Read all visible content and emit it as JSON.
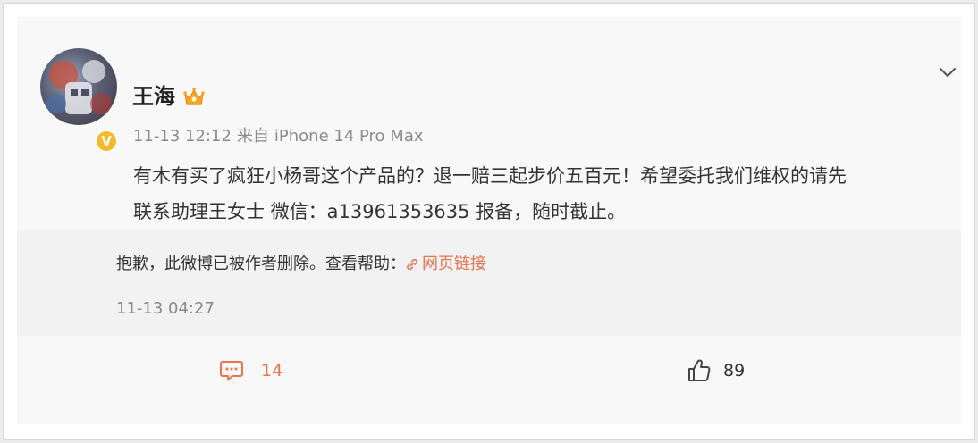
{
  "post": {
    "username": "王海",
    "time": "11-13 12:12",
    "source_prefix": "来自",
    "source": "iPhone 14 Pro Max",
    "text_line1": "有木有买了疯狂小杨哥这个产品的？退一赔三起步价五百元！希望委托我们维权的请先",
    "text_line2": "联系助理王女士 微信：a13961353635 报备，随时截止。",
    "verified_mark": "V"
  },
  "repost": {
    "deleted_text": "抱歉，此微博已被作者删除。查看帮助：",
    "link_label": "网页链接",
    "time": "11-13 04:27"
  },
  "actions": {
    "comment_count": "14",
    "like_count": "89"
  },
  "icons": {
    "expand": "chevron-down-icon",
    "crown": "crown-icon",
    "comment": "comment-icon",
    "like": "thumbs-up-icon",
    "link": "link-icon"
  },
  "colors": {
    "accent": "#eb7350",
    "verified": "#f6b92b",
    "meta": "#8a8a8a"
  }
}
